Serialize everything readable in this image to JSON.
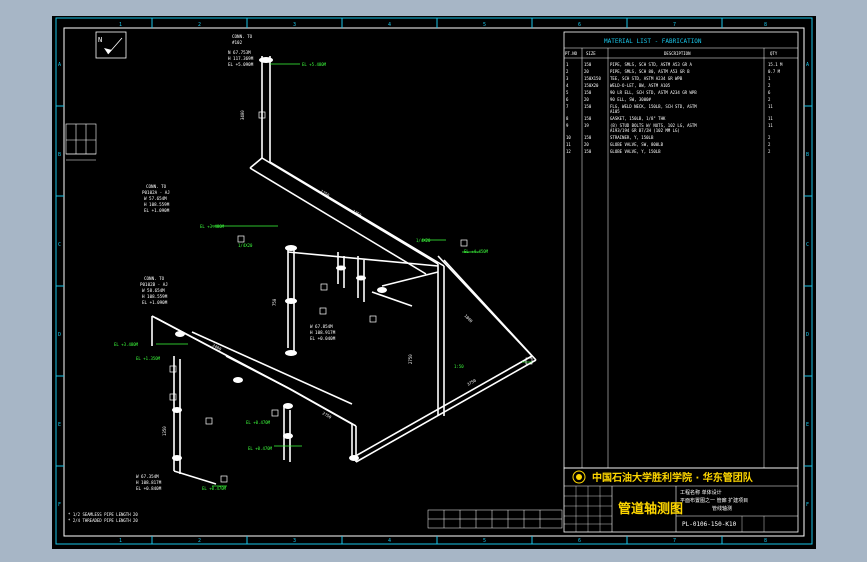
{
  "ruler": {
    "top": [
      "1",
      "2",
      "3",
      "4",
      "5",
      "6",
      "7",
      "8"
    ],
    "side": [
      "A",
      "B",
      "C",
      "D",
      "E",
      "F"
    ]
  },
  "north": "N",
  "material_list": {
    "title": "MATERIAL LIST - FABRICATION",
    "headers": [
      "PT.NO",
      "SIZE",
      "DESCRIPTION",
      "QTY"
    ],
    "rows": [
      [
        "1",
        "150",
        "PIPE, SMLS, SCH STD, ASTM A53 GR A",
        "15.1 M"
      ],
      [
        "2",
        "20",
        "PIPE, SMLS, SCH 80, ASTM A53 GR B",
        "0.7 M"
      ],
      [
        "3",
        "150X150",
        "TEE, SCH STD, ASTM A234 GR WPB",
        "1"
      ],
      [
        "4",
        "150X20",
        "WELD-O-LET, BW, ASTM A105",
        "2"
      ],
      [
        "5",
        "150",
        "90 LR ELL, SCH STD, ASTM A234 GR WPB",
        "6"
      ],
      [
        "6",
        "20",
        "90 ELL, SW, 3000#",
        "2"
      ],
      [
        "7",
        "150",
        "FLG, WELD NECK, 150LB, SCH STD, ASTM A105",
        "11"
      ],
      [
        "8",
        "150",
        "GASKET, 150LB, 1/8\" THK",
        "11"
      ],
      [
        "9",
        "19",
        "(B) STUD BOLTS W/ NUTS, 102 LG, ASTM A193/194 GR B7/2H (102 MM LG)",
        "11"
      ],
      [
        "10",
        "150",
        "STRAINER, Y, 150LB",
        "2"
      ],
      [
        "11",
        "20",
        "GLOBE VALVE, SW, 800LB",
        "2"
      ],
      [
        "12",
        "150",
        "GLOBE VALVE, Y, 150LB",
        "2"
      ]
    ]
  },
  "title_block": {
    "school": "中国石油大学胜利学院 · 华东管团队",
    "drawing_title": "管道轴测图",
    "project_line1": "工程名称  单体设计",
    "project_line2": "平面布置图之一 管廊 扩建项目",
    "project_line3": "管线轴测",
    "drawing_no": "PL-0106-150-K10"
  },
  "iso_labels": {
    "conn_top": "CONN. TO",
    "conn_top_ref": "#102",
    "conn_top_coords": [
      "N 67.753M",
      "H 117.369M",
      "EL +5.090M"
    ],
    "conn_left": "CONN. TO",
    "conn_left_ref": "P0102A - AJ",
    "conn_left_coords": [
      "W 57.654M",
      "H 108.559M",
      "EL +1.090M"
    ],
    "conn_low": "CONN. TO",
    "conn_low_ref": "P0102B - AJ",
    "conn_low_coords": [
      "W 58.654M",
      "H 108.559M",
      "EL +1.090M"
    ],
    "mid_coords": [
      "W 67.854M",
      "H 108.917M",
      "EL +0.040M"
    ],
    "bottom_coords": [
      "W 67.354M",
      "H 108.817M",
      "EL +0.840M"
    ],
    "tags": [
      "EL +5.480M",
      "EL +3.480M",
      "1/4X20",
      "1/4X20",
      "EL +4.450M",
      "EL +3.480M",
      "EL +1.350M",
      "EL +0.470M",
      "EL +0.470M",
      "EL +0.470M",
      "1:50"
    ],
    "dims": [
      "3400",
      "1750",
      "1750",
      "1800",
      "2750",
      "3750",
      "2750",
      "2400",
      "1350",
      "750"
    ],
    "footnotes": [
      "* 1/2 SEAMLESS PIPE LENGTH 20",
      "* 2/4 THREADED PIPE LENGTH 20"
    ]
  }
}
